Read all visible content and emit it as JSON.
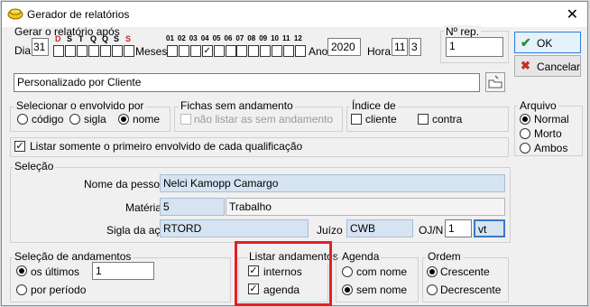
{
  "window": {
    "title": "Gerador de relatórios"
  },
  "gerar": {
    "label": "Gerar o relatório após",
    "dia_label": "Dia",
    "dia_value": "31",
    "weekdays": [
      "D",
      "S",
      "T",
      "Q",
      "Q",
      "S",
      "S"
    ],
    "months": [
      "01",
      "02",
      "03",
      "04",
      "05",
      "06",
      "07",
      "08",
      "09",
      "10",
      "11",
      "12"
    ],
    "meses_label": "Meses",
    "ano_label": "Ano",
    "ano_value": "2020",
    "hora_label": "Hora",
    "hora_h": "11",
    "hora_m": "3",
    "checked_month": "04"
  },
  "nrep": {
    "label": "Nº rep.",
    "value": "1"
  },
  "buttons": {
    "ok": "OK",
    "cancel": "Cancelar"
  },
  "report_name": "Personalizado por Cliente",
  "envolvido": {
    "label": "Selecionar o envolvido por",
    "options": [
      "código",
      "sigla",
      "nome"
    ],
    "selected": "nome"
  },
  "fichas": {
    "label": "Fichas sem andamento",
    "option": "não listar as sem andamento"
  },
  "indice": {
    "label": "Índice de",
    "cliente": "cliente",
    "contra": "contra"
  },
  "arquivo": {
    "label": "Arquivo",
    "options": [
      "Normal",
      "Morto",
      "Ambos"
    ],
    "selected": "Normal"
  },
  "listar_primeiro": "Listar somente o primeiro envolvido de cada qualificação",
  "selecao": {
    "label": "Seleção",
    "pessoa_label": "Nome da pessoa",
    "pessoa_value": "Nelci Kamopp Camargo",
    "materia_label": "Matéria",
    "materia_code": "5",
    "materia_desc": "Trabalho",
    "sigla_label": "Sigla da ação",
    "sigla_value": "RTORD",
    "juizo_label": "Juízo",
    "juizo_value": "CWB",
    "ojn_label": "OJ/N",
    "ojn_value": "1",
    "ojn_extra": "vt"
  },
  "andamentos": {
    "label": "Seleção de andamentos",
    "ultimos": "os últimos",
    "ultimos_value": "1",
    "periodo": "por período"
  },
  "listar": {
    "label": "Listar andamentos",
    "internos": "internos",
    "agenda": "agenda"
  },
  "agenda": {
    "label": "Agenda",
    "com": "com nome",
    "sem": "sem nome"
  },
  "ordem": {
    "label": "Ordem",
    "crescente": "Crescente",
    "decrescente": "Decrescente"
  },
  "colors": {
    "highlight_red": "#e42020",
    "field_blue": "#d6e4f2",
    "ok_green": "#2e8b2e",
    "cancel_red": "#c0302a"
  }
}
